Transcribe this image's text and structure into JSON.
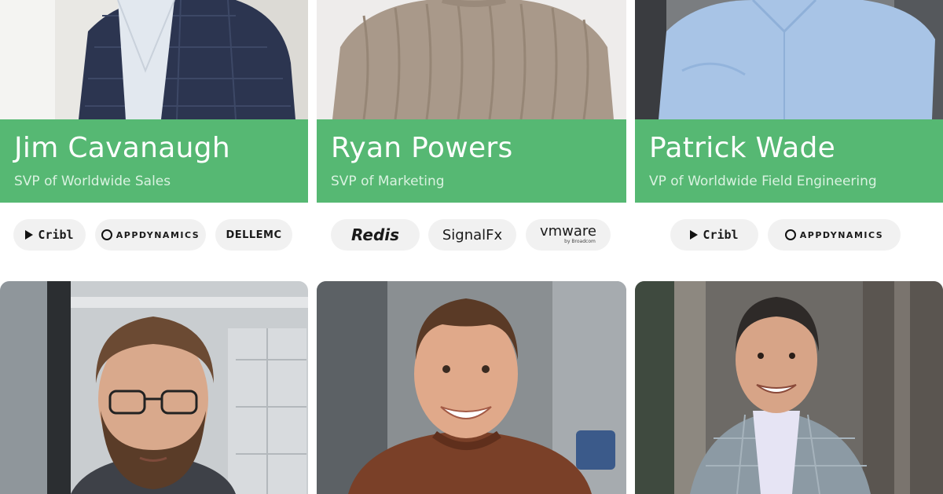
{
  "people": [
    {
      "name": "Jim Cavanaugh",
      "role": "SVP of Worldwide Sales",
      "logos": [
        {
          "label": "Cribl",
          "icon": "cribl-mark"
        },
        {
          "label": "APPDYNAMICS",
          "icon": "appdynamics-mark"
        },
        {
          "label": "DELLEMC"
        }
      ]
    },
    {
      "name": "Ryan Powers",
      "role": "SVP of Marketing",
      "logos": [
        {
          "label": "Redis"
        },
        {
          "label": "SignalFx"
        },
        {
          "label": "vmware",
          "sub": "by Broadcom"
        }
      ]
    },
    {
      "name": "Patrick Wade",
      "role": "VP of Worldwide Field Engineering",
      "logos": [
        {
          "label": "Cribl",
          "icon": "cribl-mark"
        },
        {
          "label": "APPDYNAMICS",
          "icon": "appdynamics-mark"
        }
      ]
    }
  ],
  "colors": {
    "band_green": "#56b873",
    "pill_bg": "#f1f1f1"
  }
}
